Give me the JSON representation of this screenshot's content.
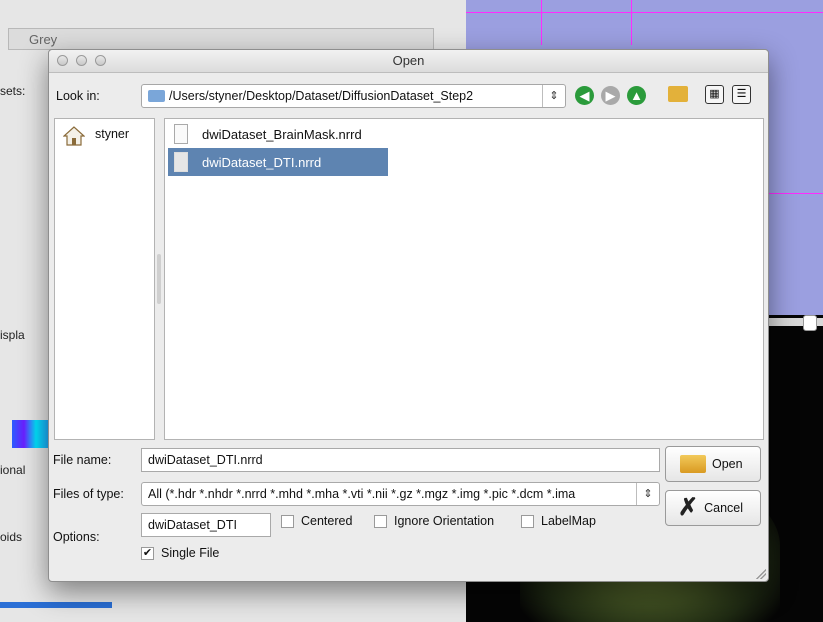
{
  "background": {
    "grey_dropdown": "Grey",
    "left_fragments": [
      "sets:",
      "ispla",
      "ional",
      "oids"
    ],
    "accent_line": "#ff2bff",
    "viewer_top_color": "#9b9fe0"
  },
  "dialog": {
    "title": "Open",
    "look_in_label": "Look in:",
    "look_in_path": "/Users/styner/Desktop/Dataset/DiffusionDataset_Step2",
    "toolbar_icons": [
      "back-icon",
      "forward-icon",
      "parent-dir-icon",
      "new-folder-icon",
      "icon-view-icon",
      "detail-view-icon"
    ],
    "sidebar": {
      "items": [
        {
          "label": "styner",
          "icon": "home-icon"
        }
      ]
    },
    "files": [
      {
        "name": "dwiDataset_BrainMask.nrrd",
        "selected": false
      },
      {
        "name": "dwiDataset_DTI.nrrd",
        "selected": true
      }
    ],
    "file_name_label": "File name:",
    "file_name_value": "dwiDataset_DTI.nrrd",
    "files_of_type_label": "Files of type:",
    "files_of_type_value": "All (*.hdr *.nhdr *.nrrd *.mhd *.mha *.vti *.nii *.gz *.mgz *.img *.pic *.dcm *.ima",
    "open_label": "Open",
    "cancel_label": "Cancel",
    "options_label": "Options:",
    "options_name": "dwiDataset_DTI",
    "checkboxes": [
      {
        "label": "Centered",
        "checked": false
      },
      {
        "label": "Ignore Orientation",
        "checked": false
      },
      {
        "label": "LabelMap",
        "checked": false
      },
      {
        "label": "Single File",
        "checked": true
      }
    ],
    "selection_color": "#5e84b1"
  }
}
